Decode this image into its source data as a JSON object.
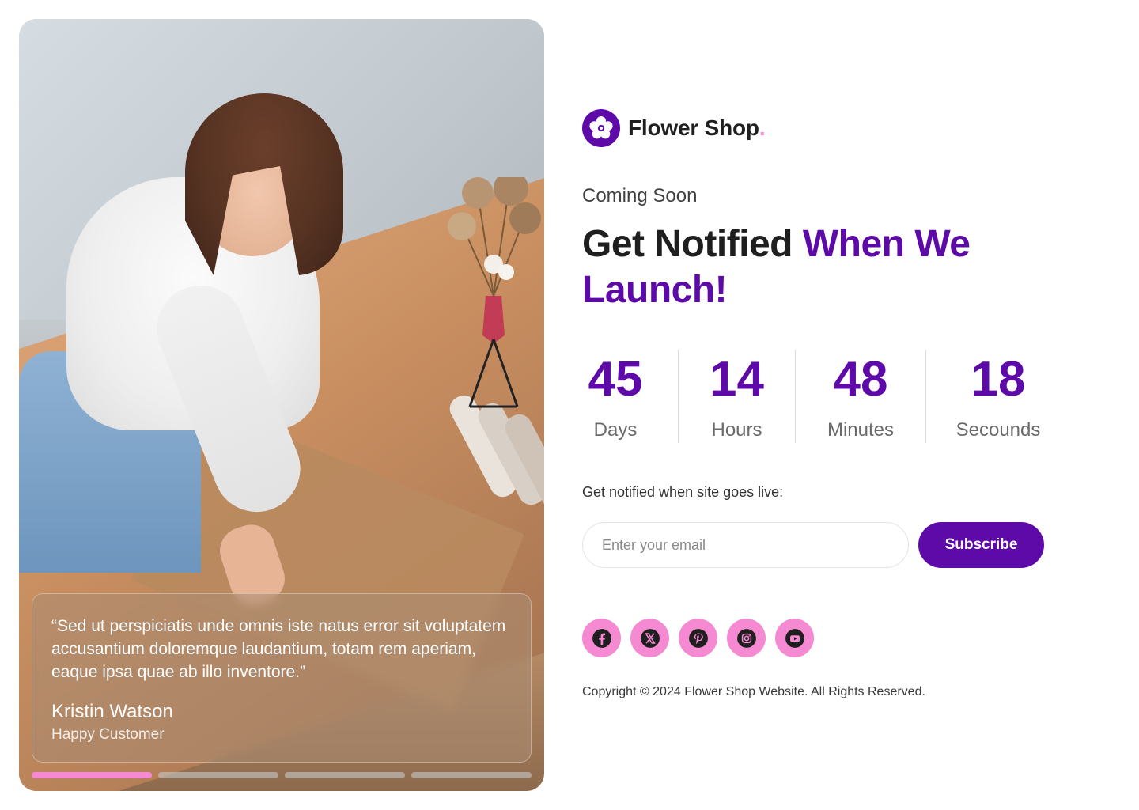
{
  "brand": {
    "name": "Flower Shop",
    "dot": ".",
    "icon": "flower-icon",
    "color_primary": "#5e0aa8",
    "color_accent": "#f58ad2"
  },
  "hero": {
    "image": "florist-woman-wrapping-bouquet",
    "quote": "“Sed ut perspiciatis unde omnis iste natus error sit voluptatem accusantium doloremque laudantium, totam rem aperiam, eaque ipsa quae ab illo inventore.”",
    "author": "Kristin Watson",
    "role": "Happy Customer",
    "slides_total": 4,
    "active_slide": 1
  },
  "content": {
    "eyebrow": "Coming Soon",
    "headline_part1": "Get Notified",
    "headline_part2": "When We Launch!"
  },
  "countdown": [
    {
      "value": "45",
      "label": "Days"
    },
    {
      "value": "14",
      "label": "Hours"
    },
    {
      "value": "48",
      "label": "Minutes"
    },
    {
      "value": "18",
      "label": "Secounds"
    }
  ],
  "subscribe": {
    "label": "Get notified when site goes live:",
    "placeholder": "Enter your email",
    "value": "",
    "button": "Subscribe"
  },
  "socials": [
    {
      "name": "facebook",
      "icon": "facebook-icon"
    },
    {
      "name": "x",
      "icon": "x-icon"
    },
    {
      "name": "pinterest",
      "icon": "pinterest-icon"
    },
    {
      "name": "instagram",
      "icon": "instagram-icon"
    },
    {
      "name": "youtube",
      "icon": "youtube-icon"
    }
  ],
  "footer": {
    "copyright": "Copyright © 2024 Flower Shop Website. All Rights Reserved."
  }
}
